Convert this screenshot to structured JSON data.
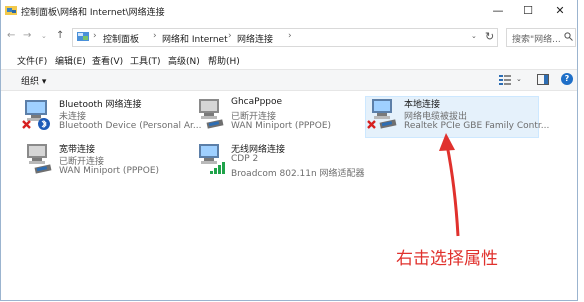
{
  "window": {
    "title": "控制面板\\网络和 Internet\\网络连接",
    "minimize_glyph": "—",
    "maximize_glyph": "☐",
    "close_glyph": "✕"
  },
  "nav": {
    "back_glyph": "←",
    "forward_glyph": "→",
    "dropdown_glyph": "⌄",
    "up_glyph": "↑",
    "breadcrumbs": [
      "控制面板",
      "网络和 Internet",
      "网络连接"
    ],
    "separator": "›",
    "refresh_glyph": "↻",
    "search_placeholder": "搜索\"网络..."
  },
  "menu": [
    "文件(F)",
    "编辑(E)",
    "查看(V)",
    "工具(T)",
    "高级(N)",
    "帮助(H)"
  ],
  "toolbar": {
    "organize_label": "组织 ▾",
    "help_glyph": "?"
  },
  "connections": [
    {
      "name": "Bluetooth 网络连接",
      "status": "未连接",
      "device": "Bluetooth Device (Personal Ar...",
      "icon": "bluetooth-network-icon",
      "selected": false
    },
    {
      "name": "GhcaPppoe",
      "status": "已断开连接",
      "device": "WAN Miniport (PPPOE)",
      "icon": "broadband-network-icon",
      "selected": false
    },
    {
      "name": "本地连接",
      "status": "网络电缆被拔出",
      "device": "Realtek PCIe GBE Family Contr...",
      "icon": "ethernet-unplugged-icon",
      "selected": true
    },
    {
      "name": "宽带连接",
      "status": "已断开连接",
      "device": "WAN Miniport (PPPOE)",
      "icon": "broadband-network-icon",
      "selected": false
    },
    {
      "name": "无线网络连接",
      "status": "CDP 2",
      "device": "Broadcom 802.11n 网络适配器",
      "icon": "wireless-network-icon",
      "selected": false
    }
  ],
  "annotation": {
    "text": "右击选择属性",
    "color": "#e0312d"
  },
  "colors": {
    "error_red": "#d62020",
    "signal_green": "#1fa34a",
    "selection": "#e5f1fb",
    "help_blue": "#1e6fc8"
  }
}
